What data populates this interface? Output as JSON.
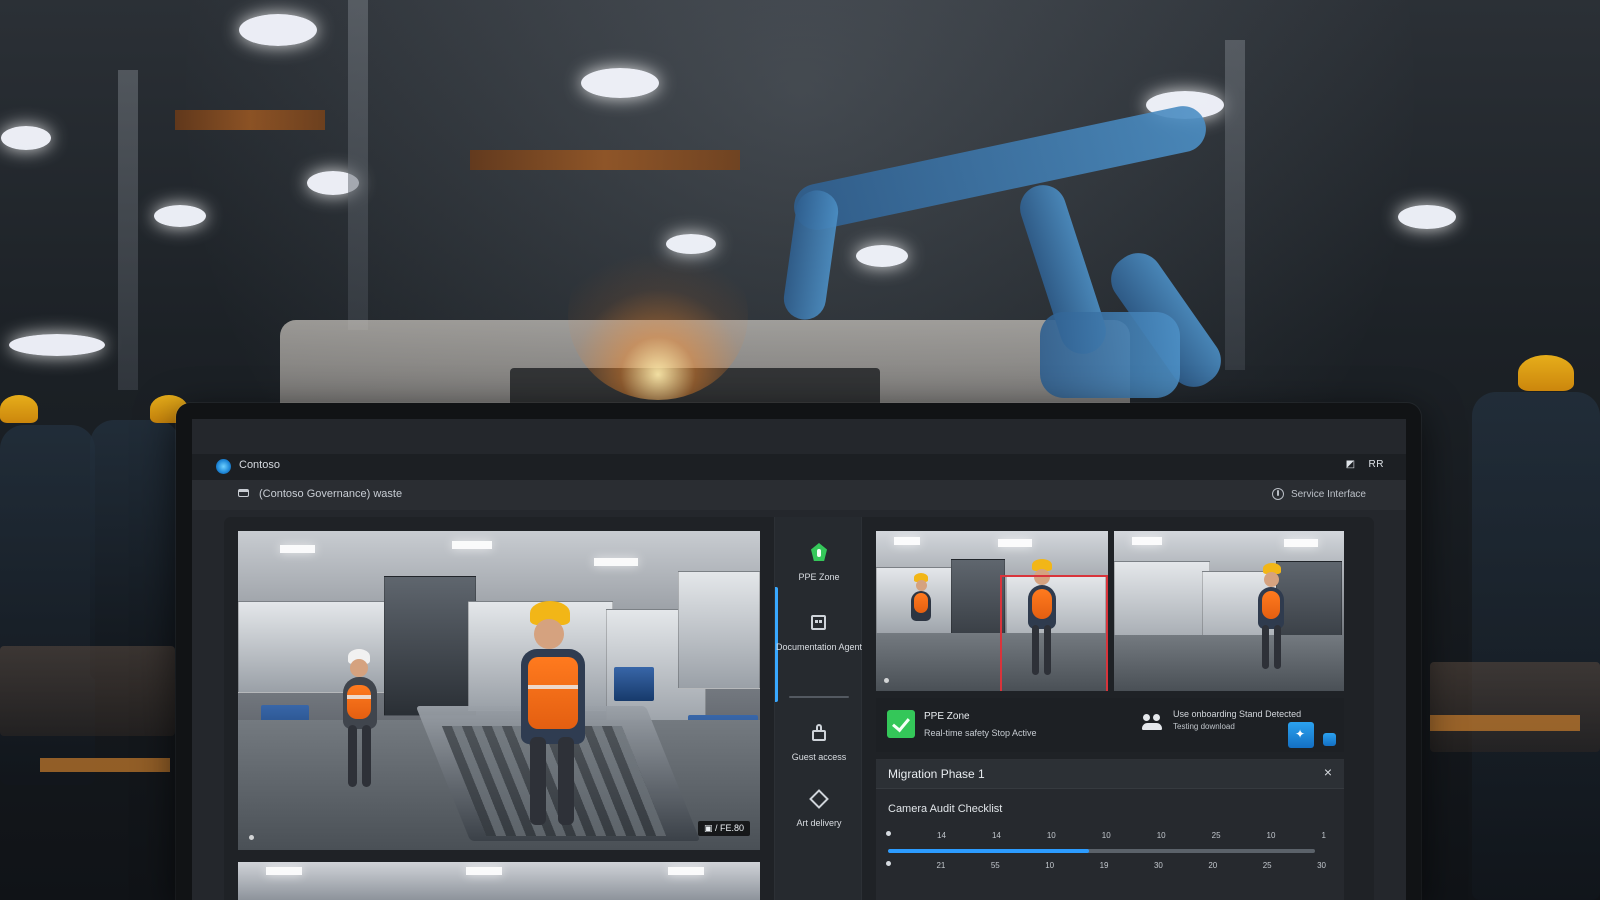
{
  "window": {
    "title": "Contoso"
  },
  "titlebar": {
    "icons": [
      "◩",
      "RR"
    ]
  },
  "workspace": {
    "title": "(Contoso Governance) waste",
    "system_status": "Service Interface"
  },
  "rail": {
    "items": [
      {
        "label": "PPE Zone"
      },
      {
        "label": "Documentation Agent"
      },
      {
        "label": "Guest access"
      },
      {
        "label": "Art delivery"
      }
    ]
  },
  "camera": {
    "main_code": "▣ / FE.80"
  },
  "status": {
    "primary_title": "PPE Zone",
    "primary_subtitle": "Real-time safety Stop Active",
    "notice_title": "Use onboarding Stand Detected",
    "notice_subtitle": "Testing download"
  },
  "panel": {
    "title": "Migration Phase 1",
    "close_label": "×",
    "checklist_title": "Camera Audit Checklist"
  },
  "timeline": {
    "top_labels": [
      "14",
      "14",
      "10",
      "10",
      "10",
      "25",
      "10",
      "1"
    ],
    "bottom_labels": [
      "21",
      "55",
      "10",
      "19",
      "30",
      "20",
      "25",
      "30"
    ],
    "progress": 0.47
  },
  "colors": {
    "accent_blue": "#2c9cff",
    "success_green": "#34c759",
    "alert_red": "#d9343b"
  }
}
